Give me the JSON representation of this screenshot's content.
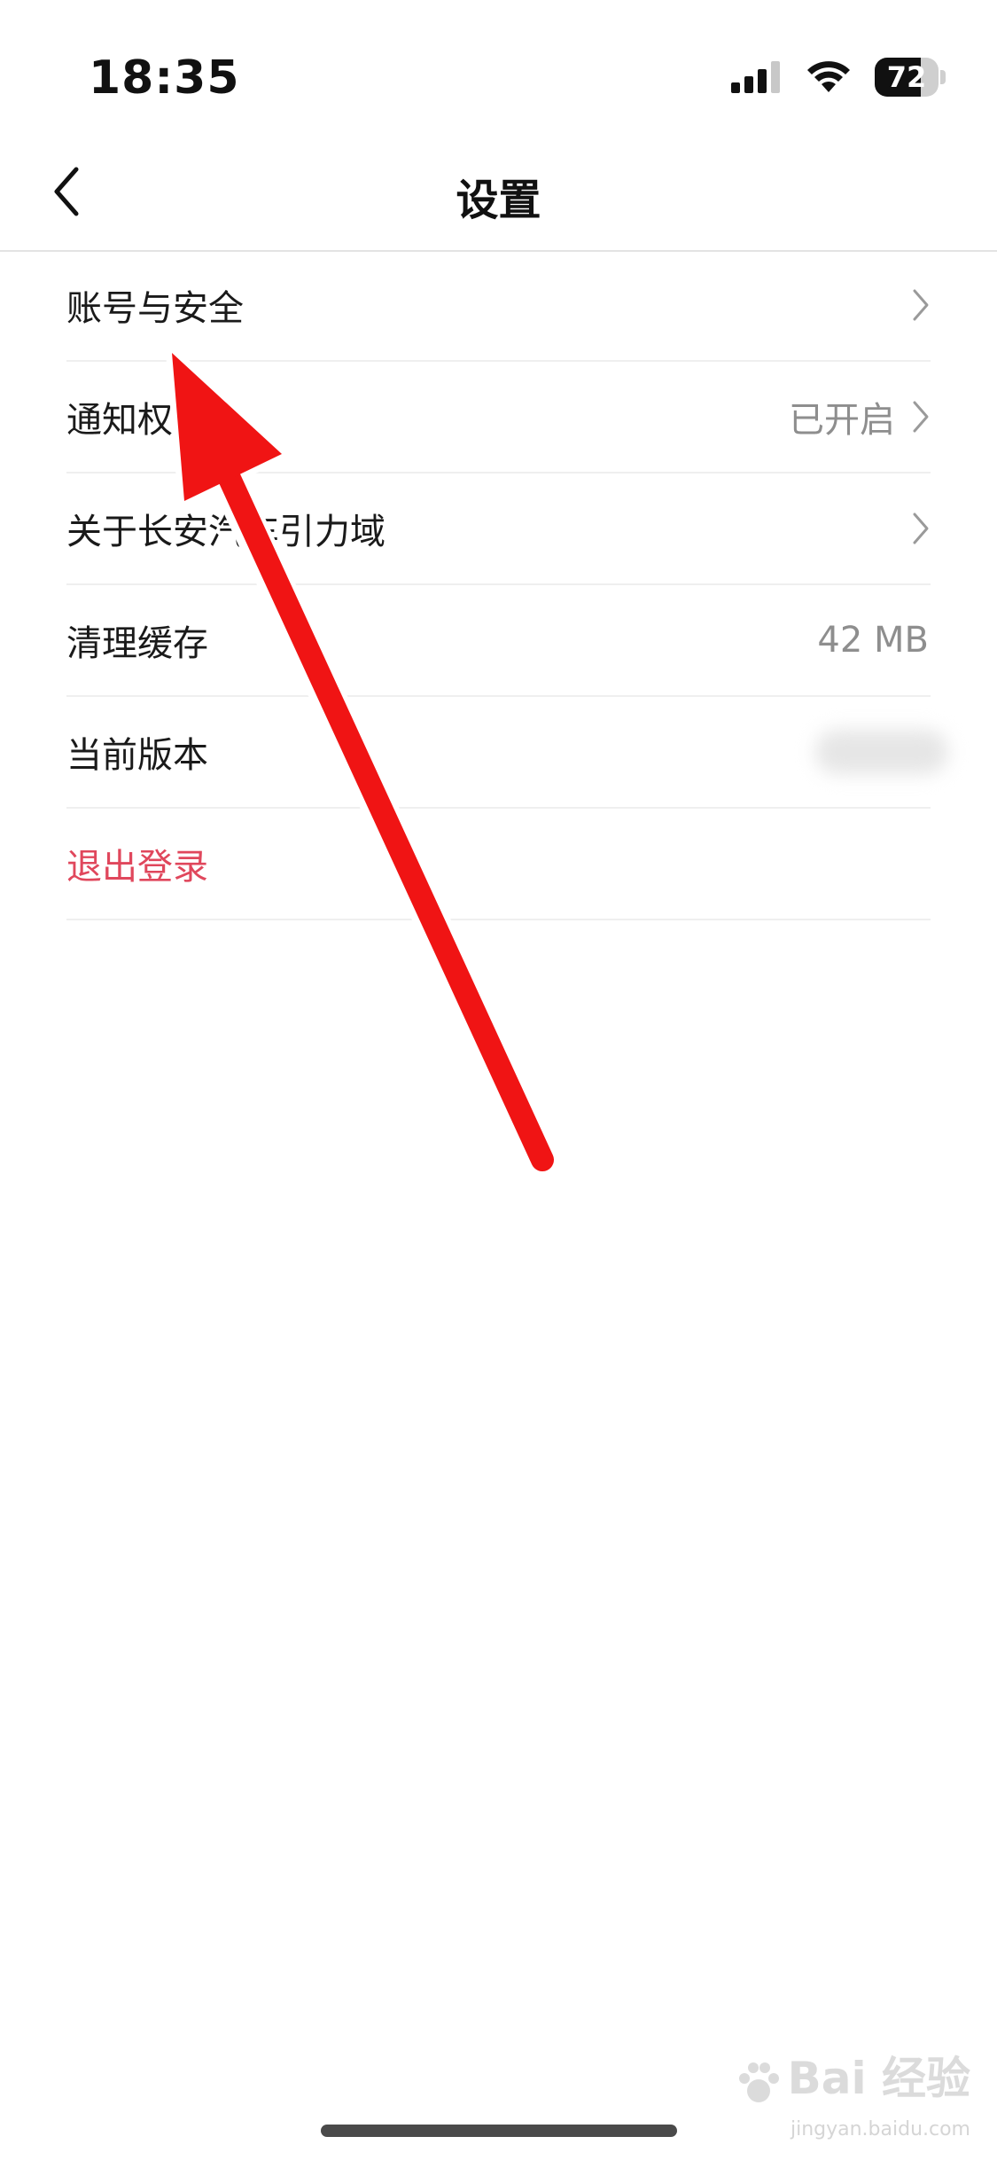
{
  "status_bar": {
    "time": "18:35",
    "battery_level": "72",
    "battery_fraction": 0.72,
    "icons": [
      "cellular-signal-icon",
      "wifi-icon",
      "battery-icon"
    ]
  },
  "nav": {
    "title": "设置",
    "back_icon": "chevron-left-icon"
  },
  "settings": {
    "items": [
      {
        "label": "账号与安全",
        "value": "",
        "chevron": true
      },
      {
        "label": "通知权限",
        "value": "已开启",
        "chevron": true
      },
      {
        "label": "关于长安汽车引力域",
        "value": "",
        "chevron": true
      },
      {
        "label": "清理缓存",
        "value": "42 MB",
        "chevron": false
      },
      {
        "label": "当前版本",
        "value": "",
        "chevron": false,
        "blurred": true
      },
      {
        "label": "退出登录",
        "value": "",
        "chevron": false,
        "danger": true
      }
    ]
  },
  "colors": {
    "danger": "#e0475c",
    "annotation_arrow": "#f01414",
    "divider": "#efefef"
  },
  "watermark": {
    "text": "Bai 经验",
    "sub": "jingyan.baidu.com"
  }
}
